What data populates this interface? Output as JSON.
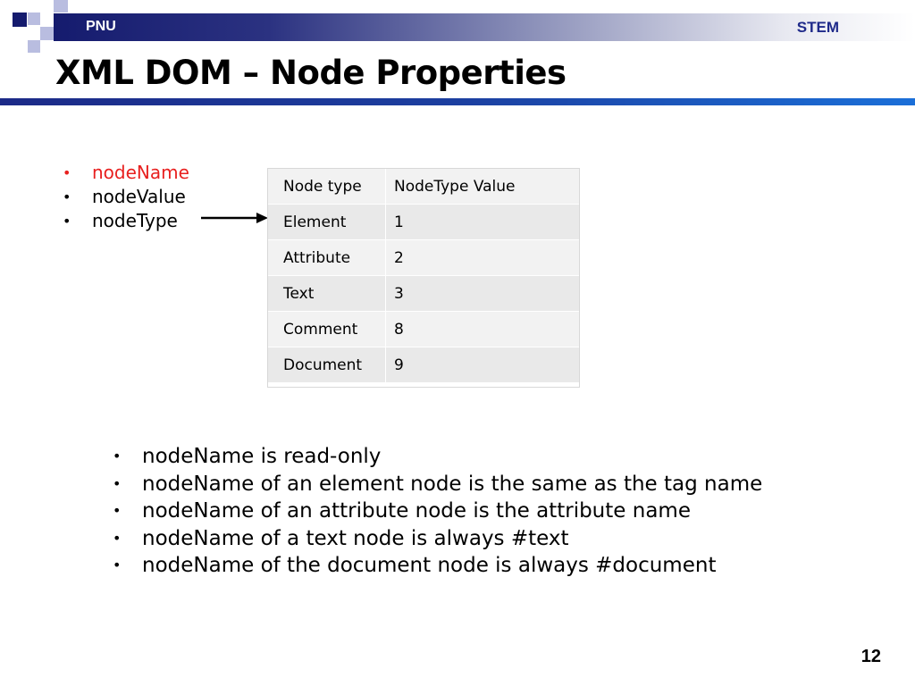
{
  "header": {
    "org": "PNU",
    "dept": "STEM",
    "title": "XML DOM – Node Properties"
  },
  "properties": [
    {
      "bullet": "•",
      "label": "nodeName"
    },
    {
      "bullet": "•",
      "label": "nodeValue"
    },
    {
      "bullet": "•",
      "label": "nodeType"
    }
  ],
  "table": {
    "headers": [
      "Node type",
      "NodeType Value"
    ],
    "rows": [
      [
        "Element",
        "1"
      ],
      [
        "Attribute",
        "2"
      ],
      [
        "Text",
        "3"
      ],
      [
        "Comment",
        "8"
      ],
      [
        "Document",
        "9"
      ]
    ]
  },
  "notes": [
    {
      "bullet": "•",
      "text": "nodeName is read-only"
    },
    {
      "bullet": "•",
      "text": "nodeName of an element node is the same as the tag name"
    },
    {
      "bullet": "•",
      "text": "nodeName of an attribute node is the attribute name"
    },
    {
      "bullet": "•",
      "text": "nodeName of a text node is always #text"
    },
    {
      "bullet": "•",
      "text": "nodeName of the document node is always #document"
    }
  ],
  "footer": {
    "page_number": "12"
  },
  "colors": {
    "accent": "#e8201f",
    "brand": "#151b6e",
    "rule": "#1b6fd8"
  }
}
